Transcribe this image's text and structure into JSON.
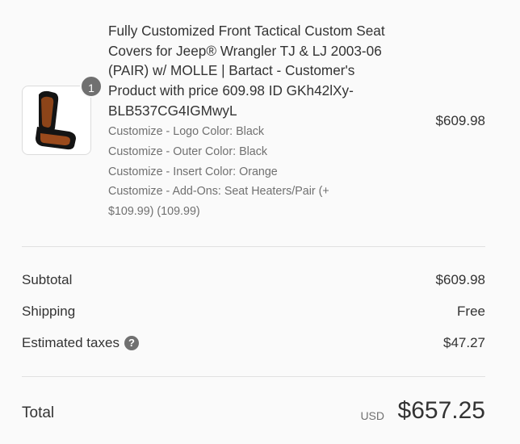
{
  "product": {
    "quantity": "1",
    "name": "Fully Customized Front Tactical Custom Seat Covers for Jeep® Wrangler TJ & LJ 2003-06 (PAIR) w/ MOLLE | Bartact - Customer's Product with price 609.98 ID GKh42lXy-BLB537CG4IGMwyL",
    "properties": [
      "Customize - Logo Color: Black",
      "Customize - Outer Color: Black",
      "Customize - Insert Color: Orange",
      "Customize - Add-Ons: Seat Heaters/Pair (+ $109.99) (109.99)"
    ],
    "price": "$609.98",
    "image_icon": "seat-cover-icon",
    "colors": {
      "seat_black": "#141414",
      "seat_orange": "#9a4a1c"
    }
  },
  "summary": {
    "subtotal_label": "Subtotal",
    "subtotal_value": "$609.98",
    "shipping_label": "Shipping",
    "shipping_value": "Free",
    "taxes_label": "Estimated taxes",
    "taxes_help_glyph": "?",
    "taxes_value": "$47.27"
  },
  "total": {
    "label": "Total",
    "currency": "USD",
    "amount": "$657.25"
  }
}
